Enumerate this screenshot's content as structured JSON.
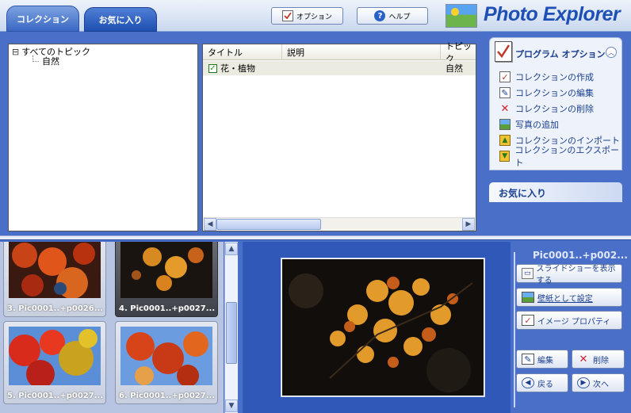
{
  "tabs": {
    "collection": "コレクション",
    "favorites": "お気に入り"
  },
  "toolbar": {
    "options_label": "オプション",
    "help_label": "ヘルプ"
  },
  "app": {
    "title": "Photo Explorer"
  },
  "tree": {
    "root": "すべてのトピック",
    "child": "自然",
    "expander": "⊟"
  },
  "list": {
    "headers": [
      "タイトル",
      "説明",
      "トピック"
    ],
    "rows": [
      {
        "title": "花・植物",
        "description": "",
        "topic": "自然",
        "checked": true
      }
    ]
  },
  "program_panel": {
    "title": "プログラム オプション",
    "items": [
      {
        "label": "コレクションの作成",
        "icon": "new-collection-icon"
      },
      {
        "label": "コレクションの編集",
        "icon": "edit-collection-icon"
      },
      {
        "label": "コレクションの削除",
        "icon": "delete-collection-icon"
      },
      {
        "label": "写真の追加",
        "icon": "add-photo-icon"
      },
      {
        "label": "コレクションのインポート",
        "icon": "import-icon"
      },
      {
        "label": "コレクションのエクスポート",
        "icon": "export-icon"
      }
    ]
  },
  "favorites_panel": {
    "title": "お気に入り"
  },
  "thumbnails": [
    {
      "caption": "3. Pic0001..+p0026...",
      "selected": false
    },
    {
      "caption": "4. Pic0001..+p0027...",
      "selected": true
    },
    {
      "caption": "5. Pic0001..+p0027...",
      "selected": false
    },
    {
      "caption": "6. Pic0001..+p0027...",
      "selected": false
    }
  ],
  "preview": {
    "title": "Pic0001..+p002..."
  },
  "actions": {
    "slideshow": "スライドショーを表示する",
    "wallpaper": "壁紙として設定",
    "properties": "イメージ プロパティ",
    "edit": "編集",
    "delete": "削除",
    "back": "戻る",
    "next": "次へ"
  },
  "colors": {
    "brand": "#1e4fb5",
    "panel_bg": "#4a6fc8",
    "preview_bg": "#2f58b8"
  }
}
